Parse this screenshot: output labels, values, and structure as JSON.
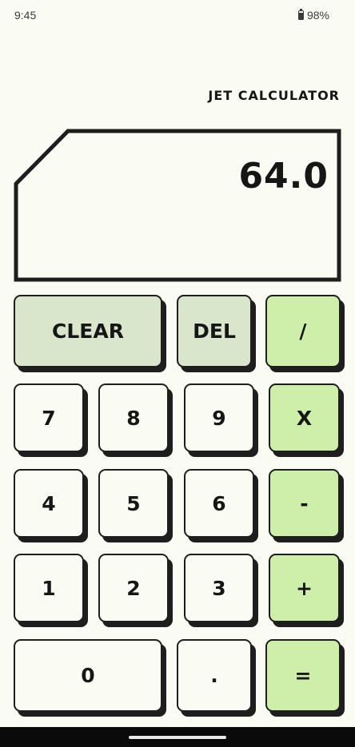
{
  "status": {
    "time": "9:45",
    "battery": "98%"
  },
  "app": {
    "title": "JET CALCULATOR"
  },
  "display": {
    "value": "64.0"
  },
  "keys": {
    "clear": "CLEAR",
    "del": "DEL",
    "divide": "/",
    "seven": "7",
    "eight": "8",
    "nine": "9",
    "multiply": "X",
    "four": "4",
    "five": "5",
    "six": "6",
    "minus": "-",
    "one": "1",
    "two": "2",
    "three": "3",
    "plus": "+",
    "zero": "0",
    "dot": ".",
    "equals": "="
  },
  "colors": {
    "background": "#fafbf2",
    "function_key": "#d9e6cc",
    "operator_key": "#cdefa9",
    "outline": "#1e1e1e"
  }
}
